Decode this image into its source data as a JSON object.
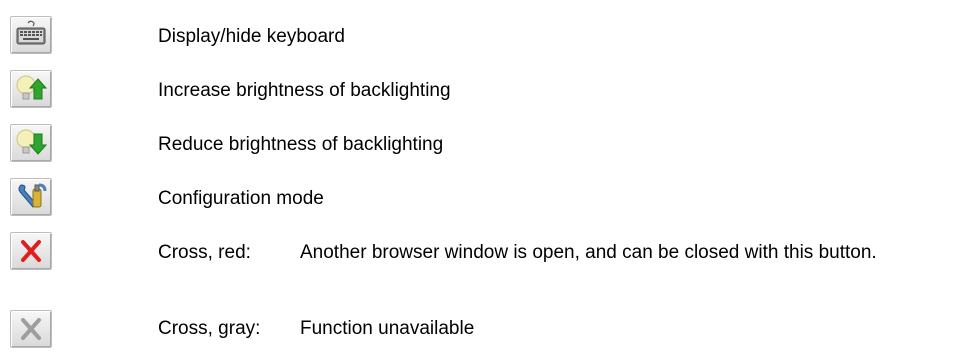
{
  "legend": {
    "items": [
      {
        "icon": "keyboard-icon",
        "label": "Display/hide keyboard"
      },
      {
        "icon": "brightness-up-icon",
        "label": "Increase brightness of backlighting"
      },
      {
        "icon": "brightness-down-icon",
        "label": "Reduce brightness of backlighting"
      },
      {
        "icon": "configuration-icon",
        "label": "Configuration mode"
      },
      {
        "icon": "close-red-icon",
        "term": "Cross, red:",
        "label": "Another browser window is open, and can be closed with this button."
      },
      {
        "icon": "close-gray-icon",
        "term": "Cross, gray:",
        "label": "Function unavailable"
      }
    ]
  },
  "colors": {
    "button_face": "#e6e6e6",
    "cross_red": "#e01e1e",
    "cross_gray": "#9e9e9e",
    "arrow_green": "#2fa52f",
    "bulb_yellow": "#f4f1b8"
  }
}
